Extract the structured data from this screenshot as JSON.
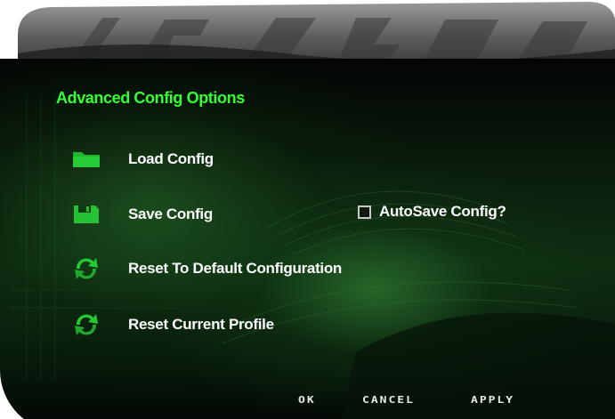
{
  "dialog": {
    "heading": "Advanced Config Options"
  },
  "options": {
    "load_config": {
      "label": "Load Config",
      "icon": "folder-icon"
    },
    "save_config": {
      "label": "Save Config",
      "icon": "floppy-disk-icon"
    },
    "reset_default": {
      "label": "Reset To Default Configuration",
      "icon": "refresh-icon"
    },
    "reset_profile": {
      "label": "Reset Current Profile",
      "icon": "refresh-icon"
    }
  },
  "autosave": {
    "label": "AutoSave Config?",
    "checked": false
  },
  "buttons": {
    "ok": "OK",
    "cancel": "CANCEL",
    "apply": "APPLY"
  },
  "colors": {
    "accent_green": "#33ff33",
    "icon_green": "#22cc33",
    "text_white": "#ffffff",
    "panel_dark": "#0b200e"
  }
}
